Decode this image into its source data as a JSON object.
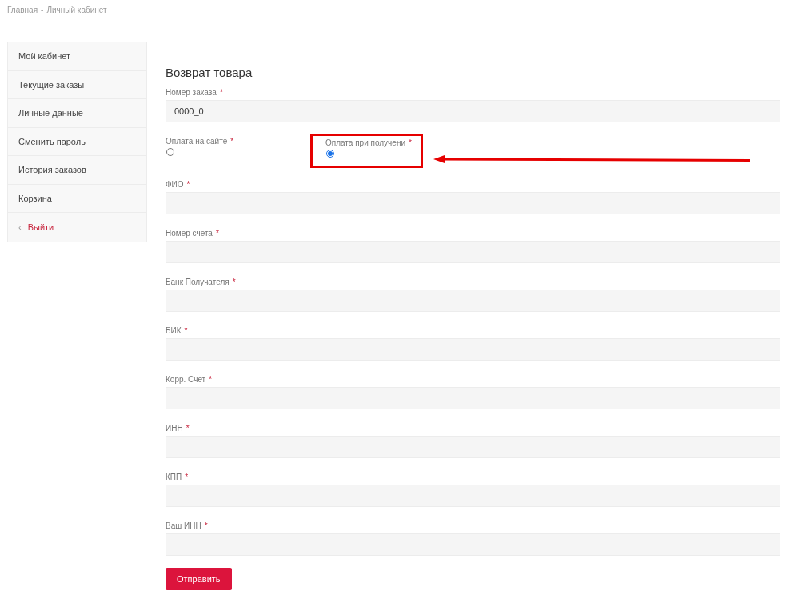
{
  "breadcrumb": [
    {
      "label": "Главная"
    },
    {
      "label": "-"
    },
    {
      "label": "Личный кабинет"
    }
  ],
  "sidebar": {
    "items": [
      {
        "label": "Мой кабинет",
        "kind": "link"
      },
      {
        "label": "Текущие заказы",
        "kind": "link"
      },
      {
        "label": "Личные данные",
        "kind": "link"
      },
      {
        "label": "Сменить пароль",
        "kind": "link"
      },
      {
        "label": "История заказов",
        "kind": "link"
      },
      {
        "label": "Корзина",
        "kind": "link"
      },
      {
        "label": "Выйти",
        "kind": "logout",
        "icon": "‹"
      }
    ]
  },
  "form": {
    "title": "Возврат товара",
    "order_field": {
      "label": "Номер заказа",
      "required_mark": "*",
      "value": "0000_0"
    },
    "payment_options": [
      {
        "label": "Оплата на сайте",
        "required_mark": "*",
        "selected": false,
        "highlighted": false
      },
      {
        "label": "Оплата при получени",
        "required_mark": "*",
        "selected": true,
        "highlighted": true
      }
    ],
    "fields": [
      {
        "label": "ФИО",
        "required_mark": "*"
      },
      {
        "label": "Номер счета",
        "required_mark": "*"
      },
      {
        "label": "Банк Получателя",
        "required_mark": "*"
      },
      {
        "label": "БИК",
        "required_mark": "*"
      },
      {
        "label": "Корр. Счет",
        "required_mark": "*"
      },
      {
        "label": "ИНН",
        "required_mark": "*"
      },
      {
        "label": "КПП",
        "required_mark": "*"
      },
      {
        "label": "Ваш ИНН",
        "required_mark": "*"
      }
    ],
    "submit": "Отправить"
  }
}
